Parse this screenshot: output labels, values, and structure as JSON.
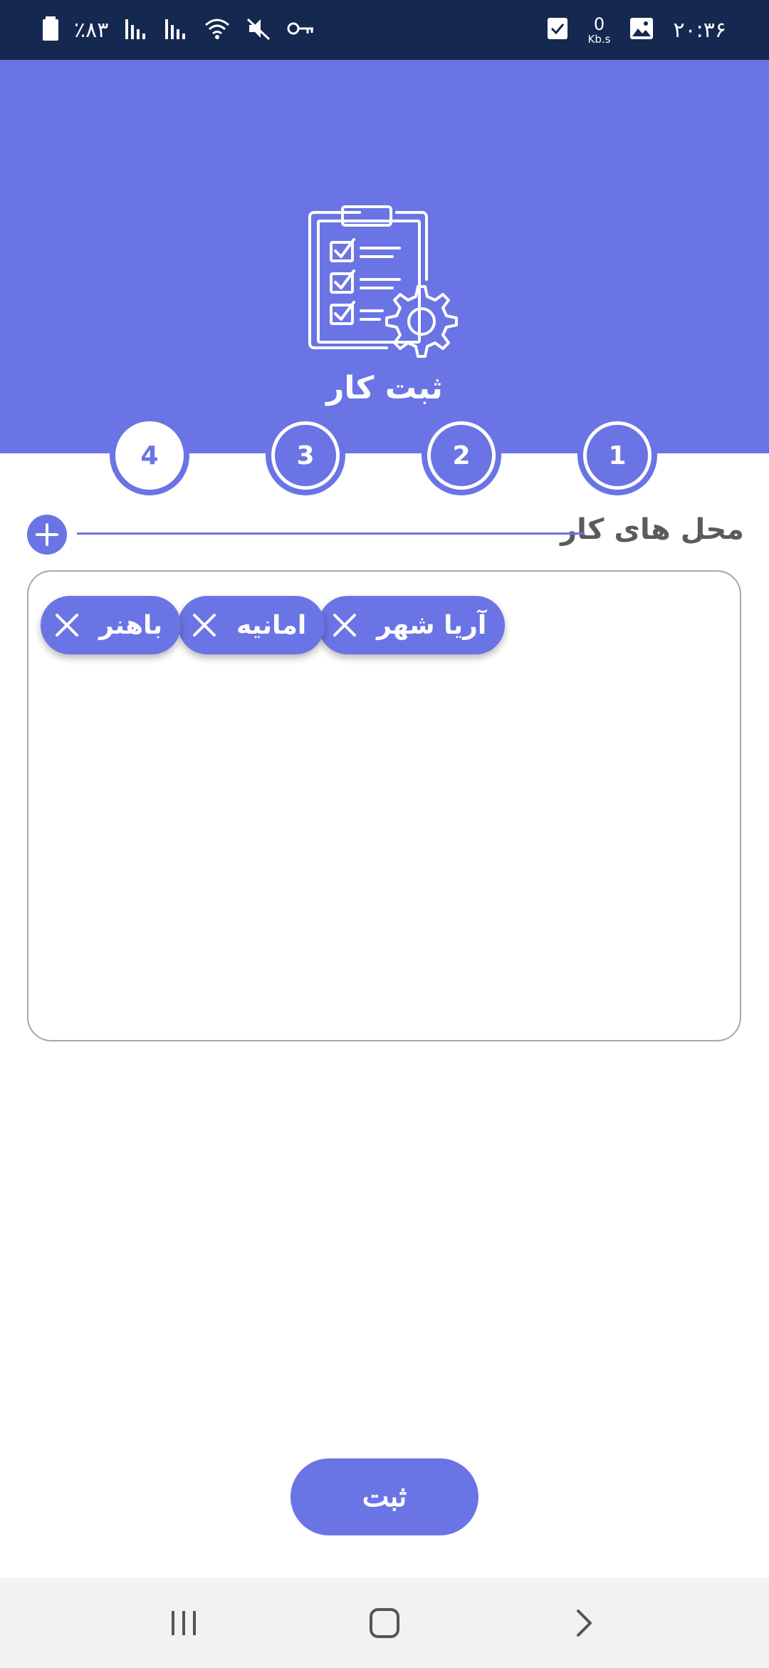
{
  "status_bar": {
    "time": "۲۰:۳۶",
    "net_speed_value": "0",
    "net_speed_unit": "Kb.s",
    "battery": "٪۸۳",
    "icons": [
      "gallery-icon",
      "check-icon",
      "key-icon",
      "mute-icon",
      "wifi-icon",
      "signal-icon",
      "signal-icon",
      "battery-icon"
    ]
  },
  "header": {
    "title": "ثبت کار",
    "icon": "clipboard-checklist-gear-icon"
  },
  "steps": [
    {
      "label": "1",
      "active": false
    },
    {
      "label": "2",
      "active": false
    },
    {
      "label": "3",
      "active": false
    },
    {
      "label": "4",
      "active": true
    }
  ],
  "section": {
    "title": "محل های کار",
    "add_icon": "plus-icon"
  },
  "chips": [
    {
      "label": "آریا شهر"
    },
    {
      "label": "امانیه"
    },
    {
      "label": "باهنر"
    }
  ],
  "submit_label": "ثبت",
  "nav_bar": {
    "icons": [
      "recent-apps-icon",
      "home-icon",
      "back-icon"
    ]
  },
  "colors": {
    "accent": "#6a74e4",
    "status_bar": "#142850",
    "section_title": "#5b5b5b",
    "nav_bar": "#f2f2f2"
  }
}
